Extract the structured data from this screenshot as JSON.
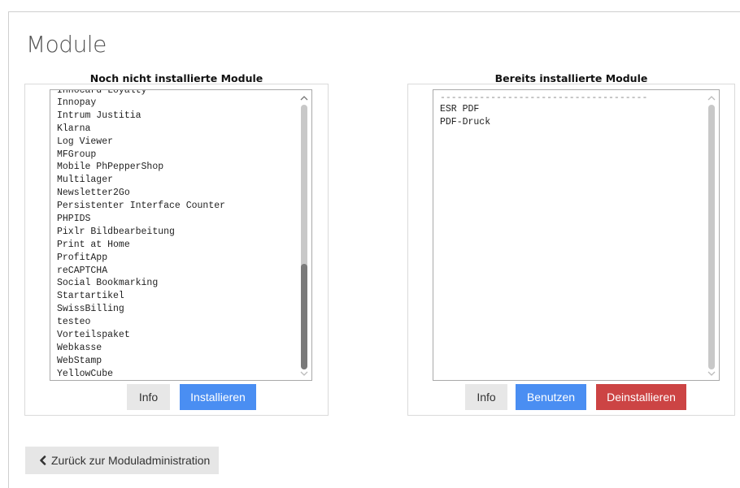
{
  "page": {
    "title": "Module"
  },
  "left_panel": {
    "title": "Noch nicht installierte Module",
    "partial_top_item": "Innocard Loyalty",
    "items": [
      "Innopay",
      "Intrum Justitia",
      "Klarna",
      "Log Viewer",
      "MFGroup",
      "Mobile PhPepperShop",
      "Multilager",
      "Newsletter2Go",
      "Persistenter Interface Counter",
      "PHPIDS",
      "Pixlr Bildbearbeitung",
      "Print at Home",
      "ProfitApp",
      "reCAPTCHA",
      "Social Bookmarking",
      "Startartikel",
      "SwissBilling",
      "testeo",
      "Vorteilspaket",
      "Webkasse",
      "WebStamp",
      "YellowCube"
    ],
    "buttons": {
      "info": "Info",
      "install": "Installieren"
    },
    "scroll_position": 0.95
  },
  "right_panel": {
    "title": "Bereits installierte Module",
    "separator": "-------------------------------------",
    "items": [
      "ESR PDF",
      "PDF-Druck"
    ],
    "buttons": {
      "info": "Info",
      "use": "Benutzen",
      "uninstall": "Deinstallieren"
    }
  },
  "back_button": {
    "label": "Zurück zur Moduladministration",
    "icon": "chevron-left-icon"
  },
  "colors": {
    "primary": "#4a8ef2",
    "danger": "#cc4444",
    "default": "#e7e7e7"
  }
}
